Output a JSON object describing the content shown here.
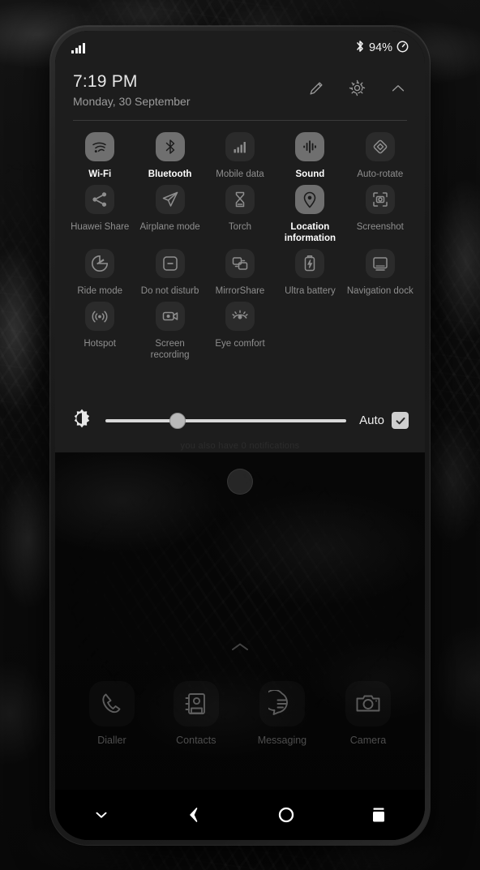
{
  "wallpaper": {
    "description": "dark fern foliage"
  },
  "status_bar": {
    "signal_icon": "signal-bars-icon",
    "bluetooth_icon": "bluetooth-icon",
    "battery_percent": "94%",
    "battery_icon": "battery-circle-icon"
  },
  "panel_header": {
    "time": "7:19 PM",
    "date": "Monday, 30 September",
    "actions": [
      {
        "name": "edit-button",
        "icon": "pencil-icon"
      },
      {
        "name": "settings-button",
        "icon": "gear-icon"
      },
      {
        "name": "collapse-button",
        "icon": "chevron-up-icon"
      }
    ]
  },
  "quick_settings": [
    {
      "label": "Wi-Fi",
      "icon": "wifi-icon",
      "active": true
    },
    {
      "label": "Bluetooth",
      "icon": "bluetooth-icon",
      "active": true
    },
    {
      "label": "Mobile data",
      "icon": "signal-bars-icon",
      "active": false
    },
    {
      "label": "Sound",
      "icon": "sound-waveform-icon",
      "active": true
    },
    {
      "label": "Auto-rotate",
      "icon": "auto-rotate-icon",
      "active": false
    },
    {
      "label": "Huawei Share",
      "icon": "share-nodes-icon",
      "active": false
    },
    {
      "label": "Airplane mode",
      "icon": "airplane-icon",
      "active": false
    },
    {
      "label": "Torch",
      "icon": "torch-icon",
      "active": false
    },
    {
      "label": "Location information",
      "icon": "location-pin-icon",
      "active": true
    },
    {
      "label": "Screenshot",
      "icon": "screenshot-icon",
      "active": false
    },
    {
      "label": "Ride mode",
      "icon": "ride-mode-icon",
      "active": false
    },
    {
      "label": "Do not disturb",
      "icon": "do-not-disturb-icon",
      "active": false
    },
    {
      "label": "MirrorShare",
      "icon": "mirrorshare-icon",
      "active": false
    },
    {
      "label": "Ultra battery",
      "icon": "ultra-battery-icon",
      "active": false
    },
    {
      "label": "Navigation dock",
      "icon": "navigation-dock-icon",
      "active": false
    },
    {
      "label": "Hotspot",
      "icon": "hotspot-icon",
      "active": false
    },
    {
      "label": "Screen recording",
      "icon": "screen-recording-icon",
      "active": false
    },
    {
      "label": "Eye comfort",
      "icon": "eye-comfort-icon",
      "active": false
    }
  ],
  "brightness": {
    "icon": "brightness-icon",
    "value_percent": 30,
    "auto_label": "Auto",
    "auto_checked": true,
    "check_icon": "check-icon"
  },
  "notification_summary": "you also have 0 notifications",
  "nav_ball": {
    "name": "floating-nav-ball"
  },
  "app_drawer_hint": {
    "icon": "chevron-up-icon"
  },
  "dock": [
    {
      "label": "Dialler",
      "icon": "phone-icon"
    },
    {
      "label": "Contacts",
      "icon": "contacts-icon"
    },
    {
      "label": "Messaging",
      "icon": "message-bubble-icon"
    },
    {
      "label": "Camera",
      "icon": "camera-icon"
    }
  ],
  "nav_bar": [
    {
      "name": "notification-collapse-button",
      "icon": "chevron-down-icon"
    },
    {
      "name": "back-button",
      "icon": "back-arrow-icon"
    },
    {
      "name": "home-button",
      "icon": "circle-icon"
    },
    {
      "name": "recents-button",
      "icon": "recents-icon"
    }
  ],
  "colors": {
    "panel_bg": "#1d1d1d",
    "active_chip": "#6f6f6f",
    "inactive_chip": "#2b2b2b",
    "nav_bar_bg": "#000000"
  }
}
